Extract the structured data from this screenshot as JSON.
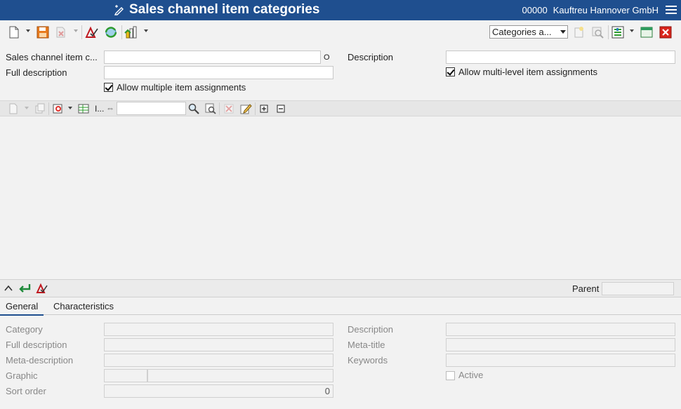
{
  "titlebar": {
    "title": "Sales channel item categories",
    "company_code": "00000",
    "company_name": "Kauftreu Hannover GmbH",
    "title_icon": "edit-pen-icon",
    "menu_icon": "hamburger-icon",
    "bg_color": "#1f4f8f"
  },
  "toolbar": {
    "icons": [
      "new-document-icon",
      "save-icon",
      "delete-icon",
      "check-icon",
      "refresh-icon",
      "export-icon"
    ],
    "view_combo": "Categories a...",
    "right_icons": [
      "new-item-icon",
      "search-icon",
      "settings-icon",
      "window-icon",
      "close-icon"
    ]
  },
  "header": {
    "code_label": "Sales channel item c...",
    "code_value": "",
    "code_suffix": "O",
    "description_label": "Description",
    "description_value": "",
    "full_description_label": "Full description",
    "full_description_value": "",
    "allow_multiple_label": "Allow multiple item assignments",
    "allow_multiple_checked": true,
    "allow_multilevel_label": "Allow multi-level item assignments",
    "allow_multilevel_checked": true
  },
  "tree_toolbar": {
    "indicator_label": "I...",
    "search_value": "",
    "expand_symbol": "+",
    "collapse_symbol": "−"
  },
  "detail_bar": {
    "parent_label": "Parent",
    "parent_value": ""
  },
  "tabs": [
    {
      "label": "General",
      "active": true
    },
    {
      "label": "Characteristics",
      "active": false
    }
  ],
  "detail": {
    "category_label": "Category",
    "category_value": "",
    "full_description_label": "Full description",
    "full_description_value": "",
    "meta_description_label": "Meta-description",
    "meta_description_value": "",
    "graphic_label": "Graphic",
    "sort_order_label": "Sort order",
    "sort_order_value": "0",
    "description_label": "Description",
    "description_value": "",
    "meta_title_label": "Meta-title",
    "meta_title_value": "",
    "keywords_label": "Keywords",
    "keywords_value": "",
    "active_label": "Active",
    "active_checked": false
  }
}
